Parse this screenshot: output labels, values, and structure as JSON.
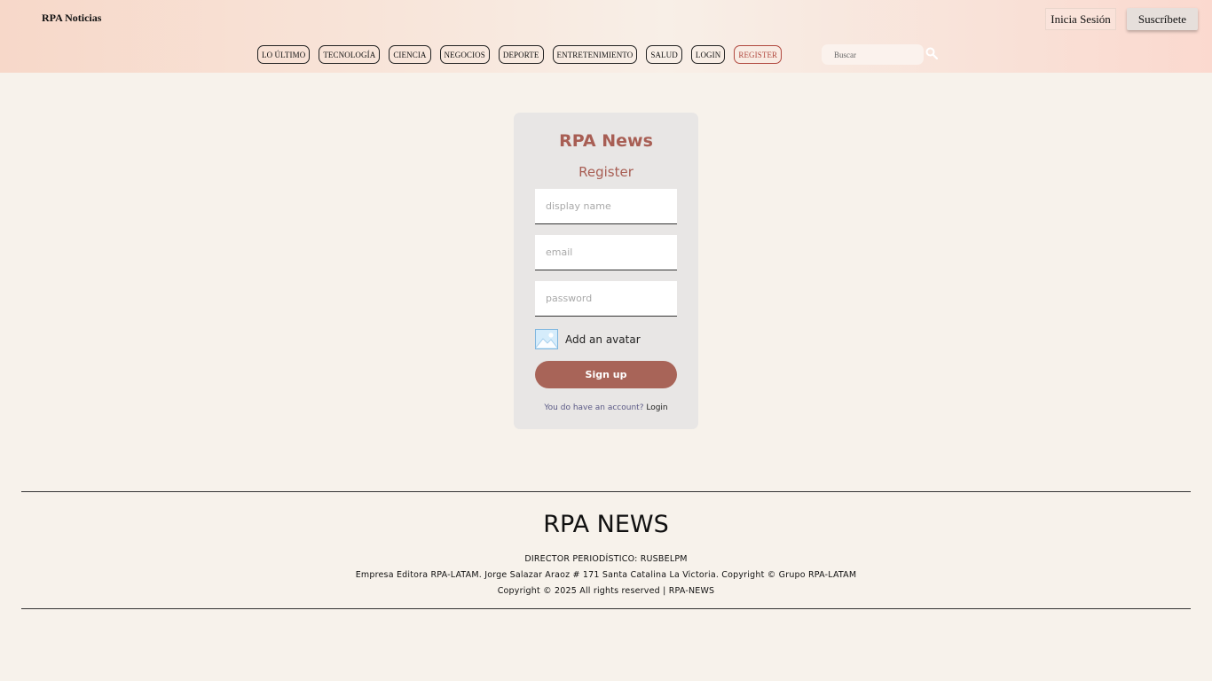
{
  "header": {
    "brand": "RPA Noticias",
    "login_label": "Inicia Sesión",
    "subscribe_label": "Suscríbete",
    "nav": [
      {
        "label": "LO ÚLTIMO"
      },
      {
        "label": "TECNOLOGÍA"
      },
      {
        "label": "CIENCIA"
      },
      {
        "label": "NEGOCIOS"
      },
      {
        "label": "DEPORTE"
      },
      {
        "label": "ENTRETENIMIENTO"
      },
      {
        "label": "SALUD"
      },
      {
        "label": "LOGIN"
      },
      {
        "label": "REGISTER",
        "active": true
      }
    ],
    "search": {
      "placeholder": "Buscar",
      "value": "",
      "icon": "search-icon"
    }
  },
  "register": {
    "title": "RPA News",
    "subtitle": "Register",
    "fields": {
      "display_name": {
        "placeholder": "display name",
        "value": ""
      },
      "email": {
        "placeholder": "email",
        "value": ""
      },
      "password": {
        "placeholder": "password",
        "value": ""
      }
    },
    "avatar": {
      "label": "Add an avatar",
      "icon": "image-icon"
    },
    "submit_label": "Sign up",
    "account_prompt": "You do have an account?",
    "account_link": "Login"
  },
  "footer": {
    "title": "RPA NEWS",
    "director": "DIRECTOR PERIODÍSTICO: RUSBELPM",
    "company": "Empresa Editora RPA-LATAM. Jorge Salazar Araoz # 171 Santa Catalina La Victoria. Copyright © Grupo RPA-LATAM",
    "copyright": "Copyright © 2025 All rights reserved | RPA-NEWS"
  },
  "colors": {
    "accent": "#a86458",
    "active_nav": "#b0473d",
    "background": "#f7f2eb",
    "card": "#e8e6e5"
  }
}
